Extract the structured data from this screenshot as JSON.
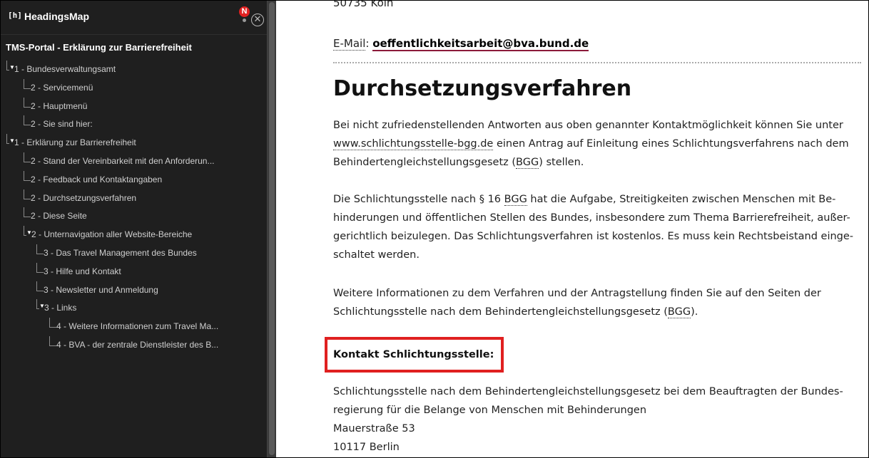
{
  "sidebar": {
    "logo": "[h]",
    "app_title": "HeadingsMap",
    "badge": "N",
    "close_symbol": "✕",
    "doc_title": "TMS-Portal - Erklärung zur Barrierefreiheit",
    "items": [
      {
        "label": "1 - Bundesverwaltungsamt",
        "level": 1,
        "collapsible": true
      },
      {
        "label": "2 - Servicemenü",
        "level": 2
      },
      {
        "label": "2 - Hauptmenü",
        "level": 2
      },
      {
        "label": "2 - Sie sind hier:",
        "level": 2
      },
      {
        "label": "1 - Erklärung zur Barrierefreiheit",
        "level": 1,
        "collapsible": true
      },
      {
        "label": "2 - Stand der Vereinbarkeit mit den Anforderun...",
        "level": 2
      },
      {
        "label": "2 - Feedback und Kontaktangaben",
        "level": 2
      },
      {
        "label": "2 - Durchsetzungsverfahren",
        "level": 2
      },
      {
        "label": "2 - Diese Seite",
        "level": 2
      },
      {
        "label": "2 - Unternavigation aller Website-Bereiche",
        "level": 2,
        "collapsible": true
      },
      {
        "label": "3 - Das Travel Management des Bundes",
        "level": 3
      },
      {
        "label": "3 - Hilfe und Kontakt",
        "level": 3
      },
      {
        "label": "3 - Newsletter und Anmeldung",
        "level": 3
      },
      {
        "label": "3 - Links",
        "level": 3,
        "collapsible": true
      },
      {
        "label": "4 - Weitere Informationen zum Travel Ma...",
        "level": 4
      },
      {
        "label": "4 - BVA - der zentrale Dienstleister des B...",
        "level": 4
      }
    ]
  },
  "main": {
    "top_partial": "50735 Köln",
    "email_prefix": "E-Mail",
    "email_colon": ": ",
    "email": "oeffentlichkeitsarbeit@bva.bund.de",
    "heading": "Durchsetzungsverfahren",
    "p1_a": "Bei nicht zufriedenstellenden Antworten aus oben genannter Kontaktmöglichkeit können Sie unter ",
    "p1_link": "www.schlichtungsstelle-bgg.de",
    "p1_b": " einen Antrag auf Einleitung eines Schlichtungsverfahrens nach dem Behindertengleichstellungsgesetz (",
    "p1_abbr": "BGG",
    "p1_c": ") stellen.",
    "p2_a": "Die Schlichtungsstelle nach § 16 ",
    "p2_abbr": "BGG",
    "p2_b": " hat die Aufgabe, Streitigkeiten zwischen Menschen mit Be-hinderungen und öffentlichen Stellen des Bundes, insbesondere zum Thema Barrierefreiheit, außer-gerichtlich beizulegen. Das Schlichtungsverfahren ist kostenlos. Es muss kein Rechtsbeistand einge-schaltet werden.",
    "p3_a": "Weitere Informationen zu dem Verfahren und der Antragstellung finden Sie auf den Seiten der Schlichtungsstelle nach dem Behindertengleichstellungsgesetz (",
    "p3_abbr": "BGG",
    "p3_b": ").",
    "kontakt_label": "Kontakt Schlichtungsstelle:",
    "addr_line1": "Schlichtungsstelle nach dem Behindertengleichstellungsgesetz bei dem Beauftragten der Bundes-regierung für die Belange von Menschen mit Behinderungen",
    "addr_street": "Mauerstraße 53",
    "addr_city": "10117 Berlin"
  },
  "colors": {
    "sidebar_bg": "#1f1f1f",
    "highlight_box": "#e02020",
    "link_underline": "#8b1a3a"
  }
}
